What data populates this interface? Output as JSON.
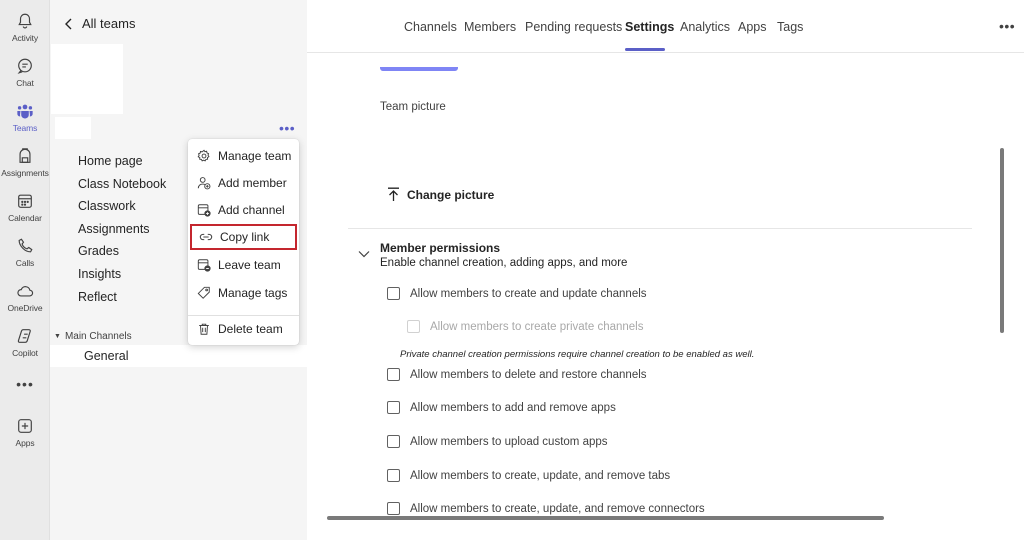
{
  "rail": {
    "items": [
      {
        "label": "Activity",
        "icon": "bell-icon"
      },
      {
        "label": "Chat",
        "icon": "chat-icon"
      },
      {
        "label": "Teams",
        "icon": "teams-icon"
      },
      {
        "label": "Assignments",
        "icon": "backpack-icon"
      },
      {
        "label": "Calendar",
        "icon": "calendar-icon"
      },
      {
        "label": "Calls",
        "icon": "phone-icon"
      },
      {
        "label": "OneDrive",
        "icon": "cloud-icon"
      },
      {
        "label": "Copilot",
        "icon": "copilot-icon"
      }
    ],
    "more": "•••",
    "apps": "Apps",
    "active_color": "#5b5fc7"
  },
  "panel": {
    "back_label": "All teams",
    "dots": "•••",
    "nav": [
      "Home page",
      "Class Notebook",
      "Classwork",
      "Assignments",
      "Grades",
      "Insights",
      "Reflect"
    ],
    "channels_header": "Main Channels",
    "channel": "General"
  },
  "menu": {
    "items": [
      {
        "label": "Manage team",
        "icon": "gear-icon"
      },
      {
        "label": "Add member",
        "icon": "add-person-icon"
      },
      {
        "label": "Add channel",
        "icon": "add-channel-icon"
      },
      {
        "label": "Copy link",
        "icon": "link-icon"
      },
      {
        "label": "Leave team",
        "icon": "leave-icon"
      },
      {
        "label": "Manage tags",
        "icon": "tag-icon"
      },
      {
        "label": "Delete team",
        "icon": "trash-icon"
      }
    ],
    "highlighted": "Copy link",
    "highlight_color": "#c4262e"
  },
  "tabs": {
    "items": [
      "Channels",
      "Members",
      "Pending requests",
      "Settings",
      "Analytics",
      "Apps",
      "Tags"
    ],
    "active": "Settings",
    "more": "•••"
  },
  "settings": {
    "team_picture_label": "Team picture",
    "change_picture": "Change picture",
    "member_permissions": {
      "title": "Member permissions",
      "subtitle": "Enable channel creation, adding apps, and more",
      "options": [
        {
          "label": "Allow members to create and update channels",
          "checked": false,
          "disabled": false
        },
        {
          "label": "Allow members to create private channels",
          "checked": false,
          "disabled": true
        },
        {
          "label": "Allow members to delete and restore channels",
          "checked": false,
          "disabled": false
        },
        {
          "label": "Allow members to add and remove apps",
          "checked": false,
          "disabled": false
        },
        {
          "label": "Allow members to upload custom apps",
          "checked": false,
          "disabled": false
        },
        {
          "label": "Allow members to create, update, and remove tabs",
          "checked": false,
          "disabled": false
        },
        {
          "label": "Allow members to create, update, and remove connectors",
          "checked": false,
          "disabled": false
        }
      ],
      "note": "Private channel creation permissions require channel creation to be enabled as well."
    }
  }
}
